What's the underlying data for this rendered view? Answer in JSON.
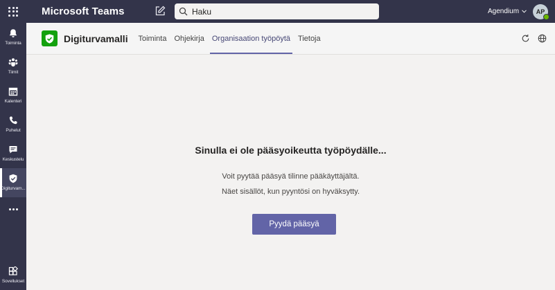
{
  "topbar": {
    "app_title": "Microsoft Teams",
    "search_placeholder": "Haku",
    "org_name": "Agendium",
    "avatar_initials": "AP"
  },
  "rail": {
    "items": [
      {
        "label": "Toiminta",
        "icon": "bell-icon"
      },
      {
        "label": "Tiimit",
        "icon": "teams-icon"
      },
      {
        "label": "Kalenteri",
        "icon": "calendar-icon"
      },
      {
        "label": "Puhelut",
        "icon": "phone-icon"
      },
      {
        "label": "Keskustelu",
        "icon": "chat-icon"
      },
      {
        "label": "Digiturvam...",
        "icon": "shield-icon",
        "active": true
      }
    ],
    "apps_label": "Sovellukset"
  },
  "app": {
    "name": "Digiturvamalli",
    "tabs": [
      {
        "label": "Toiminta"
      },
      {
        "label": "Ohjekirja"
      },
      {
        "label": "Organisaation työpöytä",
        "active": true
      },
      {
        "label": "Tietoja"
      }
    ]
  },
  "message": {
    "title": "Sinulla ei ole pääsyoikeutta työpöydälle...",
    "line1": "Voit pyytää pääsyä tilinne pääkäyttäjältä.",
    "line2": "Näet sisällöt, kun pyyntösi on hyväksytty.",
    "button": "Pyydä pääsyä"
  },
  "colors": {
    "rail_bg": "#33344a",
    "accent": "#6264a7",
    "app_logo": "#13a10e",
    "presence": "#6bb700"
  }
}
